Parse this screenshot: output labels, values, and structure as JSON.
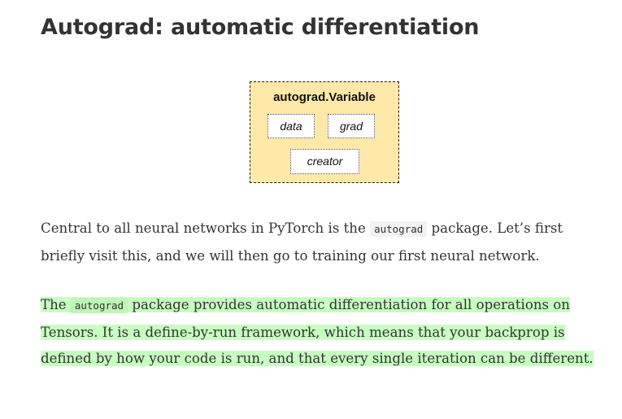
{
  "heading": "Autograd: automatic differentiation",
  "diagram": {
    "title": "autograd.Variable",
    "fields": {
      "data": "data",
      "grad": "grad",
      "creator": "creator"
    },
    "colors": {
      "fill": "#ffe8a8",
      "border": "#222222"
    }
  },
  "paragraph1": {
    "before_code": "Central to all neural networks in PyTorch is the ",
    "code": "autograd",
    "after_code": " package. Let’s first briefly visit this, and we will then go to training our first neural network."
  },
  "paragraph2": {
    "before_code": "The ",
    "code": "autograd",
    "after_code": " package provides automatic differentiation for all operations on Tensors. It is a define-by-run framework, which means that your backprop is defined by how your code is run, and that every single iteration can be different.",
    "highlight_color": "#c6ffbf"
  }
}
